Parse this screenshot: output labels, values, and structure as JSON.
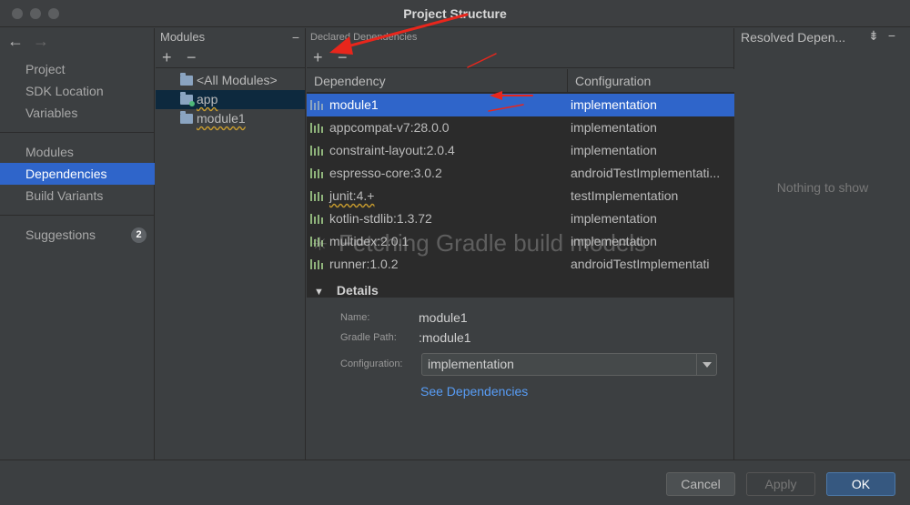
{
  "window": {
    "title": "Project Structure"
  },
  "nav": {
    "back_icon": "arrow-left-icon",
    "forward_icon": "arrow-right-icon",
    "items": [
      {
        "label": "Project"
      },
      {
        "label": "SDK Location"
      },
      {
        "label": "Variables"
      },
      {
        "label": "Modules"
      },
      {
        "label": "Dependencies"
      },
      {
        "label": "Build Variants"
      },
      {
        "label": "Suggestions",
        "badge": "2"
      }
    ],
    "selected": "Dependencies"
  },
  "modules": {
    "header": "Modules",
    "add_label": "+",
    "remove_label": "−",
    "items": [
      {
        "label": "<All Modules>"
      },
      {
        "label": "app"
      },
      {
        "label": "module1"
      }
    ],
    "selected": "app"
  },
  "declared": {
    "header": "Declared Dependencies",
    "add_label": "+",
    "remove_label": "−",
    "columns": {
      "dependency": "Dependency",
      "configuration": "Configuration"
    },
    "rows": [
      {
        "dependency": "module1",
        "configuration": "implementation"
      },
      {
        "dependency": "appcompat-v7:28.0.0",
        "configuration": "implementation"
      },
      {
        "dependency": "constraint-layout:2.0.4",
        "configuration": "implementation"
      },
      {
        "dependency": "espresso-core:3.0.2",
        "configuration": "androidTestImplementati..."
      },
      {
        "dependency": "junit:4.+",
        "configuration": "testImplementation"
      },
      {
        "dependency": "kotlin-stdlib:1.3.72",
        "configuration": "implementation"
      },
      {
        "dependency": "multidex:2.0.1",
        "configuration": "implementation"
      },
      {
        "dependency": "runner:1.0.2",
        "configuration": "androidTestImplementati"
      }
    ],
    "selected": "module1",
    "loading_overlay": "Fetching Gradle build models"
  },
  "details": {
    "header": "Details",
    "name_label": "Name:",
    "name_value": "module1",
    "path_label": "Gradle Path:",
    "path_value": ":module1",
    "configuration_label": "Configuration:",
    "configuration_value": "implementation",
    "link": "See Dependencies"
  },
  "resolved": {
    "header": "Resolved Depen...",
    "empty_text": "Nothing to show"
  },
  "footer": {
    "cancel": "Cancel",
    "apply": "Apply",
    "ok": "OK"
  },
  "colors": {
    "selection": "#2f65ca",
    "background": "#3c3f41",
    "table_background": "#2b2b2b",
    "link": "#589df6",
    "annotation_arrow": "#e8261c"
  }
}
